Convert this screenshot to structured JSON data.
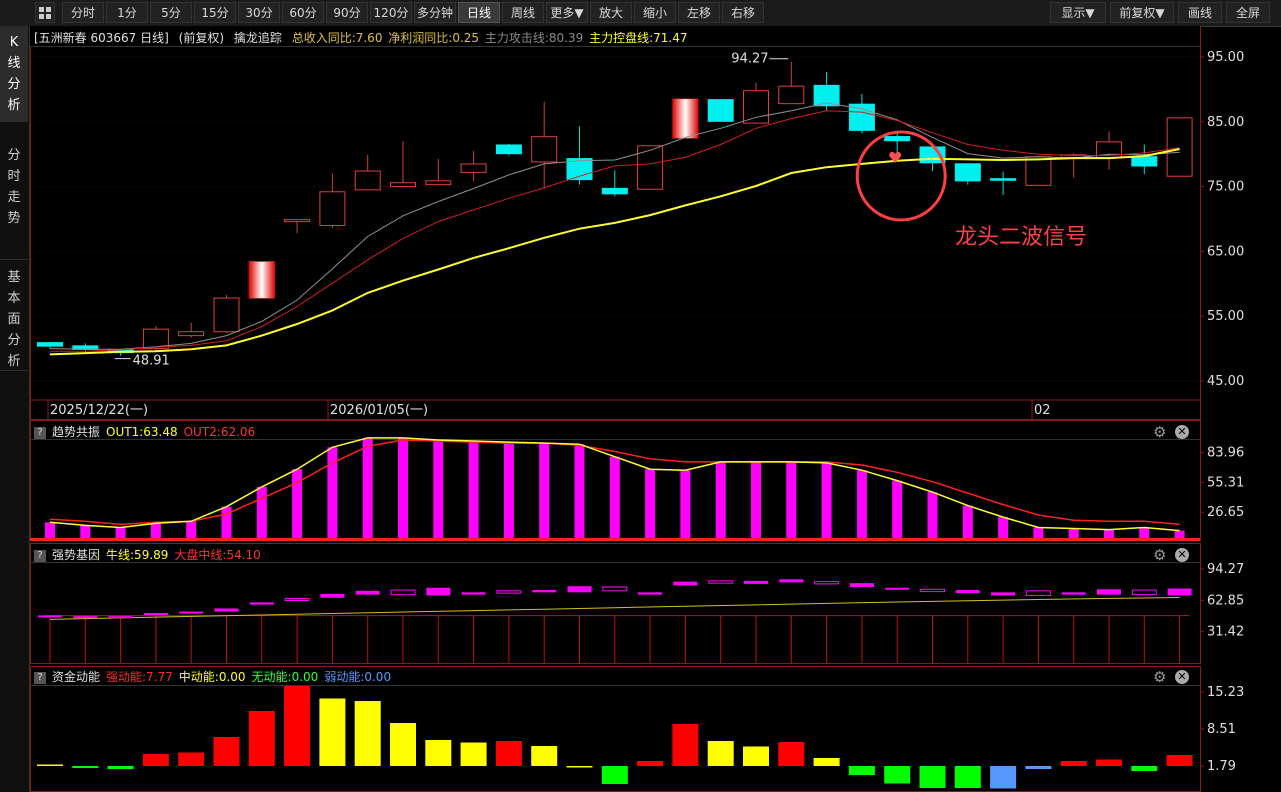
{
  "toolbar": {
    "periods": [
      "分时",
      "1分",
      "5分",
      "15分",
      "30分",
      "60分",
      "90分",
      "120分",
      "多分钟",
      "日线",
      "周线"
    ],
    "active_period": "日线",
    "more": "更多▼",
    "zoom_in": "放大",
    "zoom_out": "缩小",
    "move_left": "左移",
    "move_right": "右移",
    "display": "显示▼",
    "adjust": "前复权▼",
    "draw": "画线",
    "fullscreen": "全屏"
  },
  "sidebar": {
    "items": [
      {
        "label": "K线分析",
        "active": true
      },
      {
        "label": "分时走势",
        "active": false
      },
      {
        "label": "基本面分析",
        "active": false
      }
    ]
  },
  "main": {
    "stock": "[五洲新春 603667 日线]",
    "adjust": "(前复权)",
    "indicator": "擒龙追踪",
    "revenue": "总收入同比:7.60",
    "profit": "净利润同比:0.25",
    "attack": "主力攻击线:80.39",
    "control": "主力控盘线:71.47",
    "high_label": "94.27",
    "low_label": "48.91",
    "annotation": "龙头二波信号",
    "dates": [
      "2025/12/22(一)",
      "2026/01/05(一)",
      "02"
    ]
  },
  "pane1": {
    "title": "趋势共振",
    "out1": "OUT1:63.48",
    "out2": "OUT2:62.06"
  },
  "pane2": {
    "title": "强势基因",
    "bull": "牛线:59.89",
    "market": "大盘中线:54.10"
  },
  "pane3": {
    "title": "资金动能",
    "strong": "强动能:7.77",
    "mid": "中动能:0.00",
    "none": "无动能:0.00",
    "weak": "弱动能:0.00"
  },
  "colors": {
    "up": "#ff3333",
    "down": "#00ffff",
    "ma_yellow": "#ffff33",
    "ma_red": "#d02020",
    "magenta": "#ff00ff",
    "strong": "#ff0000",
    "mid": "#ffff00",
    "none": "#00ff00",
    "weak": "#5599ff"
  },
  "chart_data": [
    {
      "type": "candlestick",
      "title": "",
      "yticks": [
        "95.00",
        "85.00",
        "75.00",
        "65.00",
        "55.00",
        "45.00"
      ],
      "ylim": [
        43.3,
        96.1
      ],
      "xlabels": [
        "2025/12/22(一)",
        "2026/01/05(一)",
        "02"
      ],
      "candles": [
        {
          "o": 51.0,
          "c": 50.3,
          "h": 51.0,
          "l": 50.0
        },
        {
          "o": 50.5,
          "c": 49.8,
          "h": 50.8,
          "l": 49.5
        },
        {
          "o": 49.9,
          "c": 49.3,
          "h": 50.0,
          "l": 48.9
        },
        {
          "o": 50.0,
          "c": 53.0,
          "h": 53.5,
          "l": 49.6
        },
        {
          "o": 52.0,
          "c": 52.6,
          "h": 54.0,
          "l": 51.7
        },
        {
          "o": 52.6,
          "c": 57.8,
          "h": 58.3,
          "l": 52.4
        },
        {
          "o": 57.8,
          "c": 63.4,
          "h": 63.4,
          "l": 57.8
        },
        {
          "o": 69.7,
          "c": 69.9,
          "h": 70.0,
          "l": 67.8
        },
        {
          "o": 69.0,
          "c": 74.2,
          "h": 77.0,
          "l": 68.6
        },
        {
          "o": 74.5,
          "c": 77.4,
          "h": 79.9,
          "l": 74.5
        },
        {
          "o": 75.0,
          "c": 75.6,
          "h": 82.0,
          "l": 75.0
        },
        {
          "o": 75.3,
          "c": 75.9,
          "h": 79.3,
          "l": 75.3
        },
        {
          "o": 77.2,
          "c": 78.5,
          "h": 80.5,
          "l": 75.8
        },
        {
          "o": 81.5,
          "c": 80.0,
          "h": 81.6,
          "l": 79.8
        },
        {
          "o": 78.8,
          "c": 82.7,
          "h": 88.1,
          "l": 74.8
        },
        {
          "o": 79.4,
          "c": 76.0,
          "h": 84.3,
          "l": 75.3
        },
        {
          "o": 74.8,
          "c": 73.8,
          "h": 77.5,
          "l": 73.5
        },
        {
          "o": 74.6,
          "c": 81.3,
          "h": 81.3,
          "l": 74.6
        },
        {
          "o": 82.5,
          "c": 88.5,
          "h": 88.5,
          "l": 82.5
        },
        {
          "o": 88.5,
          "c": 85.0,
          "h": 88.5,
          "l": 85.0
        },
        {
          "o": 84.8,
          "c": 89.8,
          "h": 91.0,
          "l": 84.8
        },
        {
          "o": 87.8,
          "c": 90.5,
          "h": 94.27,
          "l": 87.8
        },
        {
          "o": 90.7,
          "c": 87.4,
          "h": 92.7,
          "l": 86.7
        },
        {
          "o": 87.8,
          "c": 83.6,
          "h": 89.3,
          "l": 83.2
        },
        {
          "o": 82.8,
          "c": 82.0,
          "h": 83.6,
          "l": 80.0
        },
        {
          "o": 81.2,
          "c": 78.6,
          "h": 81.2,
          "l": 77.4
        },
        {
          "o": 78.6,
          "c": 75.8,
          "h": 78.6,
          "l": 75.3
        },
        {
          "o": 76.3,
          "c": 75.9,
          "h": 77.3,
          "l": 73.7
        },
        {
          "o": 75.2,
          "c": 79.6,
          "h": 79.6,
          "l": 75.2
        },
        {
          "o": 79.5,
          "c": 79.9,
          "h": 80.2,
          "l": 76.4
        },
        {
          "o": 79.5,
          "c": 81.9,
          "h": 83.5,
          "l": 77.6
        },
        {
          "o": 79.7,
          "c": 78.1,
          "h": 81.5,
          "l": 76.9
        },
        {
          "o": 76.6,
          "c": 85.6,
          "h": 85.6,
          "l": 76.6
        }
      ],
      "ma_gray": [
        50.0,
        49.9,
        49.9,
        50.3,
        50.8,
        52.0,
        54.2,
        57.5,
        62.3,
        67.3,
        70.5,
        72.7,
        74.7,
        76.8,
        78.5,
        79.0,
        79.1,
        80.6,
        82.6,
        84.0,
        85.7,
        86.7,
        87.9,
        87.0,
        85.3,
        82.6,
        80.1,
        79.4,
        79.6,
        79.4,
        80.0,
        79.9,
        80.3
      ],
      "ma_red": [
        49.6,
        49.6,
        49.8,
        50.2,
        50.5,
        51.2,
        53.4,
        56.5,
        60.1,
        63.7,
        67.0,
        69.6,
        71.4,
        73.2,
        74.8,
        76.6,
        78.2,
        78.5,
        79.5,
        81.5,
        84.0,
        85.5,
        86.7,
        86.5,
        85.2,
        83.3,
        81.5,
        80.6,
        80.0,
        79.8,
        79.8,
        80.2,
        81.0
      ],
      "ma_yellow": [
        49.1,
        49.3,
        49.5,
        49.6,
        49.9,
        50.5,
        52.0,
        53.8,
        55.9,
        58.6,
        60.5,
        62.2,
        64.0,
        65.5,
        67.1,
        68.5,
        69.4,
        70.6,
        72.1,
        73.5,
        75.1,
        77.1,
        78.0,
        78.5,
        79.0,
        79.3,
        79.2,
        79.1,
        79.2,
        79.4,
        79.4,
        79.7,
        80.8
      ]
    },
    {
      "type": "bar",
      "title": "趋势共振",
      "yticks": [
        "83.96",
        "55.31",
        "26.65"
      ],
      "ylim": [
        0,
        96
      ],
      "series": [
        {
          "name": "OUT1",
          "values": [
            17,
            14,
            12,
            16,
            18,
            32,
            51,
            68,
            89,
            98,
            98,
            96,
            95,
            94,
            93,
            92,
            80,
            68,
            67,
            75,
            75,
            75,
            74,
            67,
            57,
            46,
            33,
            22,
            12,
            11,
            10,
            12,
            9,
            17
          ]
        },
        {
          "name": "OUT2",
          "values": [
            20,
            18,
            15,
            17,
            18,
            25,
            40,
            55,
            74,
            90,
            96,
            95,
            94,
            93,
            93,
            91,
            85,
            78,
            75,
            75,
            75,
            75,
            75,
            72,
            65,
            56,
            45,
            34,
            24,
            19,
            18,
            18,
            15,
            17
          ]
        }
      ]
    },
    {
      "type": "bar",
      "title": "强势基因",
      "yticks": [
        "94.27",
        "62.85",
        "31.42"
      ],
      "ylim": [
        0,
        100
      ],
      "boxes": [
        [
          61,
          62
        ],
        [
          61,
          61
        ],
        [
          60,
          61
        ],
        [
          63,
          65
        ],
        [
          65,
          67
        ],
        [
          67,
          71
        ],
        [
          76,
          79
        ],
        [
          84,
          83
        ],
        [
          85,
          90
        ],
        [
          89,
          94
        ],
        [
          89,
          95
        ],
        [
          88,
          98
        ],
        [
          89,
          92
        ],
        [
          91,
          94
        ],
        [
          92,
          95
        ],
        [
          92,
          100
        ],
        [
          94,
          99
        ],
        [
          89,
          92
        ],
        [
          101,
          106
        ],
        [
          104,
          107
        ],
        [
          103,
          107
        ],
        [
          105,
          109
        ],
        [
          103,
          106
        ],
        [
          99,
          104
        ],
        [
          96,
          98
        ],
        [
          93,
          96
        ],
        [
          91,
          95
        ],
        [
          88,
          92
        ],
        [
          88,
          94
        ],
        [
          89,
          92
        ],
        [
          89,
          96
        ],
        [
          89,
          95
        ],
        [
          88,
          97
        ]
      ],
      "yellow_line": [
        59.6,
        61.6,
        63.6,
        65.6,
        67.6,
        69.6,
        71.6,
        73.5,
        75.5,
        77.5,
        79.4,
        81.4,
        83.3,
        85.0,
        86.7,
        88.2,
        89.5
      ],
      "bull_values": [
        59.89,
        54.1
      ]
    },
    {
      "type": "bar",
      "title": "资金动能",
      "yticks": [
        "15.23",
        "8.51",
        "1.79"
      ],
      "ylim": [
        0,
        17
      ],
      "values": [
        0.3,
        -0.4,
        -0.6,
        2.4,
        2.7,
        5.8,
        11.0,
        16.0,
        13.5,
        13.0,
        8.6,
        5.2,
        4.7,
        5.0,
        4.0,
        -0.2,
        -3.6,
        1.0,
        8.4,
        5.0,
        3.9,
        4.8,
        1.6,
        -1.8,
        -3.5,
        -4.4,
        -4.4,
        -4.5,
        -0.6,
        1.0,
        1.3,
        -1.0,
        2.2
      ],
      "colors": [
        "yellow",
        "green",
        "green",
        "red",
        "red",
        "red",
        "red",
        "red",
        "yellow",
        "yellow",
        "yellow",
        "yellow",
        "yellow",
        "red",
        "yellow",
        "yellow",
        "green",
        "red",
        "red",
        "yellow",
        "yellow",
        "red",
        "yellow",
        "green",
        "green",
        "green",
        "green",
        "blue",
        "blue",
        "red",
        "red",
        "green",
        "red"
      ]
    }
  ]
}
